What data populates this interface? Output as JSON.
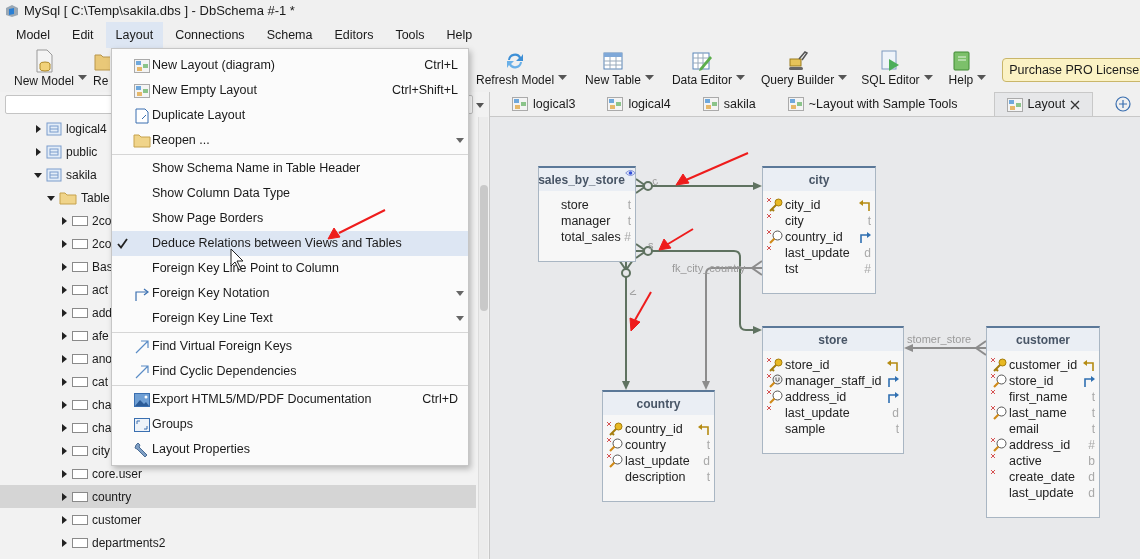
{
  "window": {
    "title": "MySql [ C:\\Temp\\sakila.dbs ] - DbSchema #-1 *"
  },
  "menu_bar": [
    {
      "label": "Model",
      "selected": false
    },
    {
      "label": "Edit",
      "selected": false
    },
    {
      "label": "Layout",
      "selected": true
    },
    {
      "label": "Connections",
      "selected": false
    },
    {
      "label": "Schema",
      "selected": false
    },
    {
      "label": "Editors",
      "selected": false
    },
    {
      "label": "Tools",
      "selected": false
    },
    {
      "label": "Help",
      "selected": false
    }
  ],
  "toolbar": [
    {
      "kind": "model",
      "label": "New Model"
    },
    {
      "kind": "open",
      "label": "Re"
    },
    {
      "kind": "refresh",
      "label": "Refresh Model"
    },
    {
      "kind": "table",
      "label": "New Table"
    },
    {
      "kind": "data",
      "label": "Data Editor"
    },
    {
      "kind": "query",
      "label": "Query Builder"
    },
    {
      "kind": "sql",
      "label": "SQL Editor"
    },
    {
      "kind": "help",
      "label": "Help"
    }
  ],
  "purchase_button": "Purchase PRO License",
  "tree": [
    {
      "kind": "schema",
      "label": "logical4",
      "expanded": false,
      "selected": false
    },
    {
      "kind": "schema",
      "label": "public",
      "expanded": false,
      "selected": false
    },
    {
      "kind": "schema",
      "label": "sakila",
      "expanded": true,
      "selected": false,
      "children": [
        {
          "kind": "folder",
          "label": "Table",
          "expanded": true,
          "selected": false,
          "children": [
            {
              "kind": "table",
              "label": "2co",
              "expanded": false,
              "selected": false
            },
            {
              "kind": "table",
              "label": "2co",
              "expanded": false,
              "selected": false
            },
            {
              "kind": "table",
              "label": "Bas",
              "expanded": false,
              "selected": false
            },
            {
              "kind": "table",
              "label": "act",
              "expanded": false,
              "selected": false
            },
            {
              "kind": "table",
              "label": "add",
              "expanded": false,
              "selected": false
            },
            {
              "kind": "table",
              "label": "afe",
              "expanded": false,
              "selected": false
            },
            {
              "kind": "table",
              "label": "ano",
              "expanded": false,
              "selected": false
            },
            {
              "kind": "table",
              "label": "cat",
              "expanded": false,
              "selected": false
            },
            {
              "kind": "table",
              "label": "cha",
              "expanded": false,
              "selected": false
            },
            {
              "kind": "table",
              "label": "cha",
              "expanded": false,
              "selected": false
            },
            {
              "kind": "table",
              "label": "city",
              "expanded": false,
              "selected": false
            },
            {
              "kind": "table",
              "label": "core.user",
              "expanded": false,
              "selected": false
            },
            {
              "kind": "table",
              "label": "country",
              "expanded": false,
              "selected": true
            },
            {
              "kind": "table",
              "label": "customer",
              "expanded": false,
              "selected": false
            },
            {
              "kind": "table",
              "label": "departments2",
              "expanded": false,
              "selected": false
            }
          ]
        }
      ]
    }
  ],
  "tabs": [
    {
      "label": "logical3",
      "selected": false
    },
    {
      "label": "logical4",
      "selected": false
    },
    {
      "label": "sakila",
      "selected": false
    },
    {
      "label": "~Layout with Sample Tools",
      "selected": false
    },
    {
      "label": "Layout",
      "selected": true
    }
  ],
  "layout_menu": [
    [
      {
        "kind": "diagram",
        "label": "New Layout (diagram)",
        "shortcut": "Ctrl+L",
        "submenu": false,
        "checked": false,
        "selected": false
      },
      {
        "kind": "diagram",
        "label": "New Empty Layout",
        "shortcut": "Ctrl+Shift+L",
        "submenu": false,
        "checked": false,
        "selected": false
      },
      {
        "kind": "duplicate",
        "label": "Duplicate Layout",
        "submenu": false,
        "checked": false,
        "selected": false
      },
      {
        "kind": "folder",
        "label": "Reopen ...",
        "submenu": true,
        "checked": false,
        "selected": false
      }
    ],
    [
      {
        "label": "Show Schema Name in Table Header",
        "submenu": false,
        "checked": false,
        "selected": false
      },
      {
        "label": "Show Column Data Type",
        "submenu": false,
        "checked": false,
        "selected": false
      },
      {
        "label": "Show Page Borders",
        "submenu": false,
        "checked": false,
        "selected": false
      },
      {
        "label": "Deduce Relations between Views and Tables",
        "submenu": false,
        "checked": true,
        "selected": true
      },
      {
        "label": "Foreign Key Line Point to Column",
        "submenu": false,
        "checked": false,
        "selected": false
      },
      {
        "kind": "notation",
        "label": "Foreign Key Notation",
        "submenu": true,
        "checked": false,
        "selected": false
      },
      {
        "label": "Foreign Key Line Text",
        "submenu": true,
        "checked": false,
        "selected": false
      }
    ],
    [
      {
        "kind": "link",
        "label": "Find Virtual Foreign Keys",
        "submenu": false,
        "checked": false,
        "selected": false
      },
      {
        "kind": "link",
        "label": "Find Cyclic Dependencies",
        "submenu": false,
        "checked": false,
        "selected": false
      }
    ],
    [
      {
        "kind": "export",
        "label": "Export HTML5/MD/PDF Documentation",
        "shortcut": "Ctrl+D",
        "submenu": false,
        "checked": false,
        "selected": false
      },
      {
        "kind": "groups",
        "label": "Groups",
        "submenu": false,
        "checked": false,
        "selected": false
      },
      {
        "kind": "properties",
        "label": "Layout Properties",
        "submenu": false,
        "checked": false,
        "selected": false
      }
    ]
  ],
  "diagram": {
    "tables": [
      {
        "name": "sales_by_store",
        "view": true,
        "columns": [
          {
            "kind": "plain",
            "name": "store",
            "type": "t",
            "required": false
          },
          {
            "kind": "plain",
            "name": "manager",
            "type": "t",
            "required": false
          },
          {
            "kind": "plain",
            "name": "total_sales",
            "type": "#",
            "required": false
          }
        ]
      },
      {
        "name": "city",
        "view": false,
        "columns": [
          {
            "kind": "primary_key",
            "name": "city_id",
            "required": true
          },
          {
            "kind": "plain",
            "name": "city",
            "type": "t",
            "required": true
          },
          {
            "kind": "foreign_key",
            "name": "country_id",
            "required": true
          },
          {
            "kind": "plain",
            "name": "last_update",
            "type": "d",
            "required": true
          },
          {
            "kind": "plain",
            "name": "tst",
            "type": "#",
            "required": false
          }
        ]
      },
      {
        "name": "store",
        "view": false,
        "columns": [
          {
            "kind": "primary_key",
            "name": "store_id",
            "required": true
          },
          {
            "kind": "unique_foreign_key",
            "name": "manager_staff_id",
            "required": true
          },
          {
            "kind": "foreign_key",
            "name": "address_id",
            "required": true
          },
          {
            "kind": "plain",
            "name": "last_update",
            "type": "d",
            "required": true
          },
          {
            "kind": "plain",
            "name": "sample",
            "type": "t",
            "required": false
          }
        ]
      },
      {
        "name": "customer",
        "view": false,
        "columns": [
          {
            "kind": "primary_key",
            "name": "customer_id",
            "required": true
          },
          {
            "kind": "foreign_key",
            "name": "store_id",
            "required": true
          },
          {
            "kind": "plain",
            "name": "first_name",
            "type": "t",
            "required": true
          },
          {
            "kind": "index",
            "name": "last_name",
            "type": "t",
            "required": true
          },
          {
            "kind": "plain",
            "name": "email",
            "type": "t",
            "required": false
          },
          {
            "kind": "index",
            "name": "address_id",
            "type": "#",
            "required": true
          },
          {
            "kind": "plain",
            "name": "active",
            "type": "b",
            "required": true
          },
          {
            "kind": "plain",
            "name": "create_date",
            "type": "d",
            "required": true
          },
          {
            "kind": "plain",
            "name": "last_update",
            "type": "d",
            "required": false
          }
        ]
      },
      {
        "name": "country",
        "view": false,
        "columns": [
          {
            "kind": "primary_key",
            "name": "country_id",
            "required": true
          },
          {
            "kind": "index",
            "name": "country",
            "type": "t",
            "required": true
          },
          {
            "kind": "index",
            "name": "last_update",
            "type": "d",
            "required": true
          },
          {
            "kind": "plain",
            "name": "description",
            "type": "t",
            "required": false
          }
        ]
      }
    ],
    "relations": [
      {
        "kind": "deduced",
        "label": "c"
      },
      {
        "kind": "deduced",
        "label": "s"
      },
      {
        "kind": "deduced",
        "label": "v"
      },
      {
        "kind": "foreign_key",
        "label": "fk_city_country"
      },
      {
        "kind": "foreign_key",
        "label": "stomer_store"
      }
    ]
  }
}
